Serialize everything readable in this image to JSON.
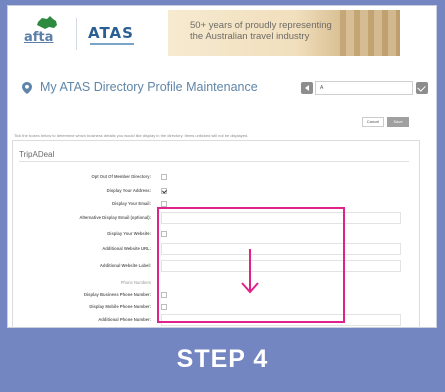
{
  "header": {
    "afta_logo_text": "afta",
    "afta_logo_sub": "",
    "atas_logo_text": "ATAS",
    "banner_line1": "50+ years of proudly representing",
    "banner_line2": "the Australian travel industry"
  },
  "page": {
    "title": "My ATAS Directory Profile Maintenance",
    "profile_select_value": "A",
    "instructions": "Tick the boxes below to determine which business details you would like display in the directory. Items unticked will not be displayed."
  },
  "actions": {
    "cancel_label": "Cancel",
    "save_label": "Save"
  },
  "section": {
    "title": "TripADeal",
    "rows": [
      {
        "label": "Opt Out Of Member Directory:",
        "type": "checkbox",
        "checked": false
      },
      {
        "label": "Display Your Address:",
        "type": "checkbox",
        "checked": true
      },
      {
        "label": "Display Your Email:",
        "type": "checkbox",
        "checked": false
      },
      {
        "label": "Alternative Display Email (optional):",
        "type": "text",
        "value": ""
      },
      {
        "label": "Display Your Website:",
        "type": "checkbox",
        "checked": false
      },
      {
        "label": "Additional Website URL:",
        "type": "text",
        "value": ""
      },
      {
        "label": "Additional Website Label:",
        "type": "text",
        "value": ""
      },
      {
        "label": "Phone Numbers",
        "type": "heading"
      },
      {
        "label": "Display Business Phone Number:",
        "type": "checkbox",
        "checked": false
      },
      {
        "label": "Display Mobile Phone Number:",
        "type": "checkbox",
        "checked": false
      },
      {
        "label": "Additional Phone Number:",
        "type": "text",
        "value": ""
      }
    ]
  },
  "step_label": "STEP 4",
  "colors": {
    "background": "#7386c2",
    "highlight": "#e0238a",
    "title": "#5f86a8"
  }
}
